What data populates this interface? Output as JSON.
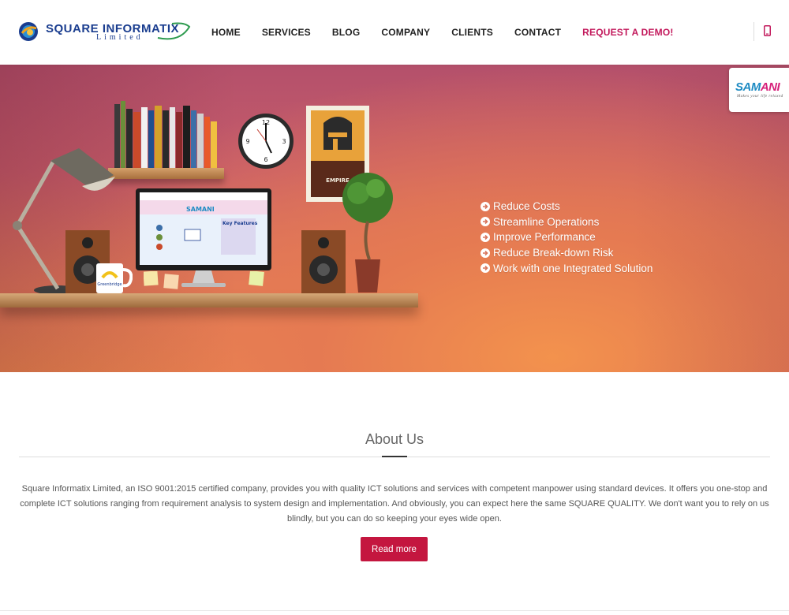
{
  "colors": {
    "accent": "#c4163f",
    "demo_link": "#c2185b",
    "logo_blue": "#1a3d8f",
    "hero_top": "#b4506b",
    "hero_bottom": "#ef8a4f"
  },
  "header": {
    "logo": {
      "name": "SQUARE INFORMATIX",
      "sub": "Limited",
      "icon": "square-informatix-logo-icon"
    },
    "nav": [
      {
        "label": "HOME"
      },
      {
        "label": "SERVICES"
      },
      {
        "label": "BLOG"
      },
      {
        "label": "COMPANY"
      },
      {
        "label": "CLIENTS"
      },
      {
        "label": "CONTACT"
      },
      {
        "label": "REQUEST A DEMO!"
      }
    ],
    "phone_icon": "mobile-phone-icon"
  },
  "hero": {
    "benefits": [
      "Reduce Costs",
      "Streamline Operations",
      "Improve Performance",
      "Reduce Break-down Risk",
      "Work with one Integrated Solution"
    ],
    "benefit_icon": "circle-arrow-right-icon",
    "screen_brand": "SAMANI",
    "screen_heading": "Key Features",
    "mug_label": "Greenbridge",
    "poster_label": "EMPIRE"
  },
  "samani_badge": {
    "brand_blue": "SAM",
    "brand_pink": "ANI",
    "tagline": "Makes your life relaxed"
  },
  "about": {
    "title": "About Us",
    "text": "Square Informatix Limited, an ISO 9001:2015 certified company, provides you with quality ICT solutions and services with competent manpower using standard devices. It offers you one-stop and complete ICT solutions ranging from requirement analysis to system design and implementation. And obviously, you can expect here the same SQUARE QUALITY. We don't want you to rely on us blindly, but you can do so keeping your eyes wide open.",
    "button": "Read more"
  }
}
